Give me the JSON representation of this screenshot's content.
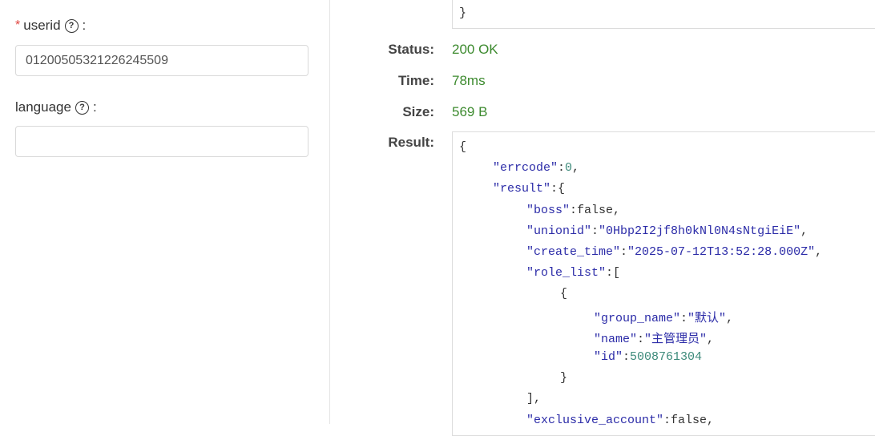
{
  "form": {
    "userid_label": "userid",
    "userid_required_mark": "*",
    "userid_value": "01200505321226245509",
    "language_label": "language",
    "language_value": "",
    "colon": ":"
  },
  "response": {
    "top_brace": "}",
    "status_label": "Status:",
    "status_value": "200 OK",
    "time_label": "Time:",
    "time_value": "78ms",
    "size_label": "Size:",
    "size_value": "569 B",
    "result_label": "Result:"
  },
  "result_json_lines": [
    {
      "indent": 0,
      "parts": [
        {
          "t": "punc",
          "v": "{"
        }
      ]
    },
    {
      "indent": 1,
      "parts": [
        {
          "t": "key",
          "v": "\"errcode\""
        },
        {
          "t": "punc",
          "v": ":"
        },
        {
          "t": "num",
          "v": "0"
        },
        {
          "t": "punc",
          "v": ","
        }
      ]
    },
    {
      "indent": 1,
      "parts": [
        {
          "t": "key",
          "v": "\"result\""
        },
        {
          "t": "punc",
          "v": ":{"
        }
      ]
    },
    {
      "indent": 2,
      "parts": [
        {
          "t": "key",
          "v": "\"boss\""
        },
        {
          "t": "punc",
          "v": ":false,"
        }
      ]
    },
    {
      "indent": 2,
      "parts": [
        {
          "t": "key",
          "v": "\"unionid\""
        },
        {
          "t": "punc",
          "v": ":"
        },
        {
          "t": "str",
          "v": "\"0Hbp2I2jf8h0kNl0N4sNtgiEiE\""
        },
        {
          "t": "punc",
          "v": ","
        }
      ]
    },
    {
      "indent": 2,
      "parts": [
        {
          "t": "key",
          "v": "\"create_time\""
        },
        {
          "t": "punc",
          "v": ":"
        },
        {
          "t": "str",
          "v": "\"2025-07-12T13:52:28.000Z\""
        },
        {
          "t": "punc",
          "v": ","
        }
      ]
    },
    {
      "indent": 2,
      "parts": [
        {
          "t": "key",
          "v": "\"role_list\""
        },
        {
          "t": "punc",
          "v": ":["
        }
      ]
    },
    {
      "indent": 3,
      "parts": [
        {
          "t": "punc",
          "v": "{"
        }
      ]
    },
    {
      "indent": 4,
      "parts": [
        {
          "t": "key",
          "v": "\"group_name\""
        },
        {
          "t": "punc",
          "v": ":"
        },
        {
          "t": "str",
          "v": "\"默认\""
        },
        {
          "t": "punc",
          "v": ","
        }
      ]
    },
    {
      "indent": 4,
      "parts": [
        {
          "t": "key",
          "v": "\"name\""
        },
        {
          "t": "punc",
          "v": ":"
        },
        {
          "t": "str",
          "v": "\"主管理员\""
        },
        {
          "t": "punc",
          "v": ","
        }
      ]
    },
    {
      "indent": 4,
      "parts": [
        {
          "t": "key",
          "v": "\"id\""
        },
        {
          "t": "punc",
          "v": ":"
        },
        {
          "t": "num",
          "v": "5008761304"
        }
      ]
    },
    {
      "indent": 3,
      "parts": [
        {
          "t": "punc",
          "v": "}"
        }
      ]
    },
    {
      "indent": 2,
      "parts": [
        {
          "t": "punc",
          "v": "],"
        }
      ]
    },
    {
      "indent": 2,
      "parts": [
        {
          "t": "key",
          "v": "\"exclusive_account\""
        },
        {
          "t": "punc",
          "v": ":false,"
        }
      ]
    }
  ]
}
